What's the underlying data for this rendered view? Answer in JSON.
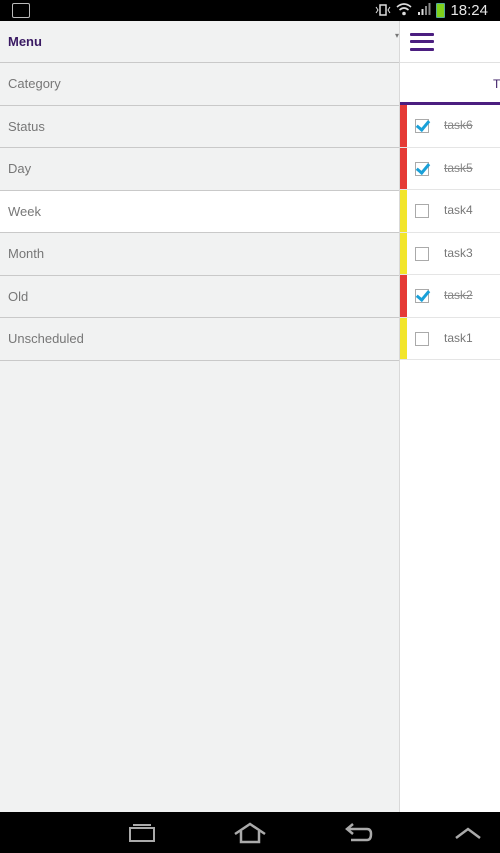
{
  "status_bar": {
    "time": "18:24",
    "icons": [
      "image-icon",
      "vibrate-icon",
      "wifi-icon",
      "signal-icon",
      "battery-icon"
    ],
    "battery_color": "#7fd11b"
  },
  "drawer": {
    "title": "Menu",
    "items": [
      {
        "label": "Category",
        "selected": false
      },
      {
        "label": "Status",
        "selected": false
      },
      {
        "label": "Day",
        "selected": false
      },
      {
        "label": "Week",
        "selected": true
      },
      {
        "label": "Month",
        "selected": false
      },
      {
        "label": "Old",
        "selected": false
      },
      {
        "label": "Unscheduled",
        "selected": false
      }
    ]
  },
  "main": {
    "tab_label": "T",
    "accent_color": "#4b1e80",
    "tasks": [
      {
        "name": "task6",
        "done": true,
        "priority_color": "#e53a35"
      },
      {
        "name": "task5",
        "done": true,
        "priority_color": "#e53a35"
      },
      {
        "name": "task4",
        "done": false,
        "priority_color": "#f2e52a"
      },
      {
        "name": "task3",
        "done": false,
        "priority_color": "#f2e52a"
      },
      {
        "name": "task2",
        "done": true,
        "priority_color": "#e53a35"
      },
      {
        "name": "task1",
        "done": false,
        "priority_color": "#f2e52a"
      }
    ]
  },
  "nav_bar": {
    "buttons": [
      "recent-apps-icon",
      "home-icon",
      "back-icon",
      "menu-up-icon"
    ]
  }
}
